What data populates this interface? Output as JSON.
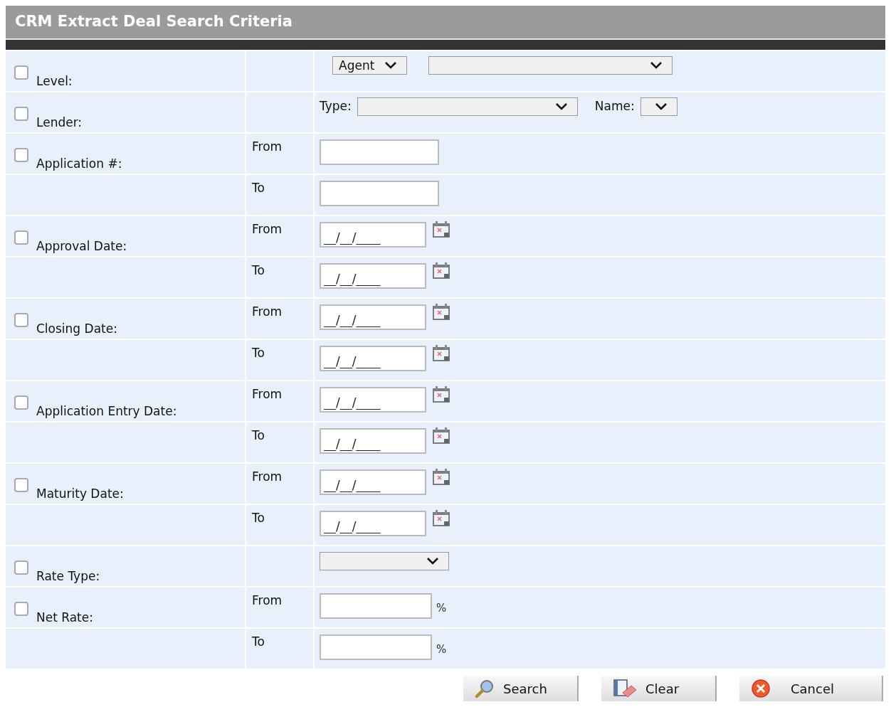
{
  "title": "CRM Extract Deal Search Criteria",
  "criteria": [
    {
      "kind": "level",
      "label": "Level:",
      "checked": false,
      "level_value": "Agent"
    },
    {
      "kind": "lender",
      "label": "Lender:",
      "checked": false,
      "type_label": "Type:",
      "name_label": "Name:"
    },
    {
      "kind": "text_range",
      "label": "Application #:",
      "checked": false,
      "from_label": "From",
      "to_label": "To"
    },
    {
      "kind": "date_range",
      "label": "Approval Date:",
      "checked": false,
      "from_label": "From",
      "to_label": "To",
      "from_value": "__/__/____",
      "to_value": "__/__/____"
    },
    {
      "kind": "date_range",
      "label": "Closing Date:",
      "checked": false,
      "from_label": "From",
      "to_label": "To",
      "from_value": "__/__/____",
      "to_value": "__/__/____"
    },
    {
      "kind": "date_range",
      "label": "Application Entry Date:",
      "checked": false,
      "from_label": "From",
      "to_label": "To",
      "from_value": "__/__/____",
      "to_value": "__/__/____"
    },
    {
      "kind": "date_range",
      "label": "Maturity Date:",
      "checked": false,
      "from_label": "From",
      "to_label": "To",
      "from_value": "__/__/____",
      "to_value": "__/__/____"
    },
    {
      "kind": "select",
      "label": "Rate Type:",
      "checked": false
    },
    {
      "kind": "percent_range",
      "label": "Net Rate:",
      "checked": false,
      "from_label": "From",
      "to_label": "To",
      "from_unit": "%",
      "to_unit": "%"
    }
  ],
  "buttons": [
    {
      "kind": "search",
      "label": "Search"
    },
    {
      "kind": "clear",
      "label": "Clear"
    },
    {
      "kind": "cancel",
      "label": "Cancel"
    }
  ]
}
